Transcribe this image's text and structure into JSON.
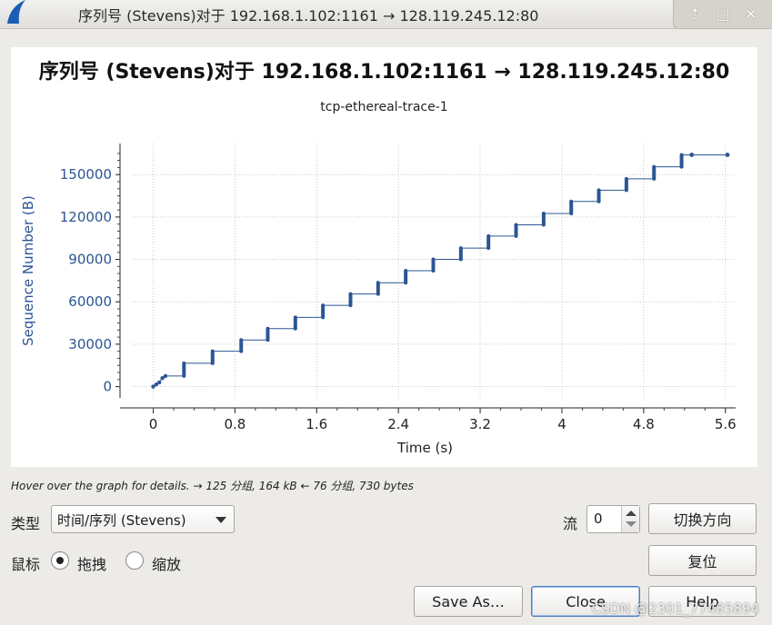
{
  "window": {
    "title": "序列号 (Stevens)对于 192.168.1.102:1161 → 128.119.245.12:80",
    "controls": {
      "up": "⇡",
      "maximize": "□",
      "close": "✕"
    }
  },
  "chart_data": {
    "type": "scatter",
    "title": "序列号 (Stevens)对于 192.168.1.102:1161 → 128.119.245.12:80",
    "subtitle": "tcp-ethereal-trace-1",
    "xlabel": "Time (s)",
    "ylabel": "Sequence Number (B)",
    "xlim": [
      -0.2,
      5.7
    ],
    "ylim": [
      -8000,
      172000
    ],
    "xticks": [
      0,
      0.8,
      1.6,
      2.4,
      3.2,
      4,
      4.8,
      5.6
    ],
    "xtick_labels": [
      "0",
      "0.8",
      "1.6",
      "2.4",
      "3.2",
      "4",
      "4.8",
      "5.6"
    ],
    "yticks": [
      0,
      30000,
      60000,
      90000,
      120000,
      150000
    ],
    "ytick_labels": [
      "0",
      "30000",
      "60000",
      "90000",
      "120000",
      "150000"
    ],
    "grid": true,
    "color": "#2c5594",
    "initial_burst": {
      "x": [
        0.0,
        0.03,
        0.06,
        0.09,
        0.12
      ],
      "y": [
        0,
        1500,
        3000,
        6000,
        7500
      ]
    },
    "bursts": [
      {
        "t": 0.31,
        "y0": 7500,
        "y1": 16500
      },
      {
        "t": 0.59,
        "y0": 16500,
        "y1": 25000
      },
      {
        "t": 0.87,
        "y0": 25000,
        "y1": 33000
      },
      {
        "t": 1.13,
        "y0": 33000,
        "y1": 41000
      },
      {
        "t": 1.4,
        "y0": 41000,
        "y1": 49000
      },
      {
        "t": 1.67,
        "y0": 49000,
        "y1": 57500
      },
      {
        "t": 1.94,
        "y0": 57500,
        "y1": 65500
      },
      {
        "t": 2.21,
        "y0": 65500,
        "y1": 73500
      },
      {
        "t": 2.48,
        "y0": 73500,
        "y1": 82000
      },
      {
        "t": 2.75,
        "y0": 82000,
        "y1": 90000
      },
      {
        "t": 3.02,
        "y0": 90000,
        "y1": 98000
      },
      {
        "t": 3.29,
        "y0": 98000,
        "y1": 106500
      },
      {
        "t": 3.56,
        "y0": 106500,
        "y1": 114500
      },
      {
        "t": 3.83,
        "y0": 114500,
        "y1": 122500
      },
      {
        "t": 4.1,
        "y0": 122500,
        "y1": 131000
      },
      {
        "t": 4.37,
        "y0": 131000,
        "y1": 139000
      },
      {
        "t": 4.64,
        "y0": 139000,
        "y1": 147000
      },
      {
        "t": 4.91,
        "y0": 147000,
        "y1": 155500
      },
      {
        "t": 5.18,
        "y0": 155500,
        "y1": 164000
      }
    ],
    "tail_points": {
      "x": [
        5.27,
        5.62
      ],
      "y": [
        164000,
        164000
      ]
    }
  },
  "hint": "Hover over the graph for details. → 125 分组, 164 kB ← 76 分组, 730 bytes",
  "controls": {
    "type_label": "类型",
    "type_value": "时间/序列 (Stevens)",
    "stream_label": "流",
    "stream_value": "0",
    "switch_direction": "切换方向",
    "mouse_label": "鼠标",
    "drag_label": "拖拽",
    "zoom_label": "缩放",
    "reset": "复位"
  },
  "buttons": {
    "save_as": "Save As…",
    "close": "Close",
    "help": "Help"
  },
  "watermark": "CSDN @2301_77485894"
}
